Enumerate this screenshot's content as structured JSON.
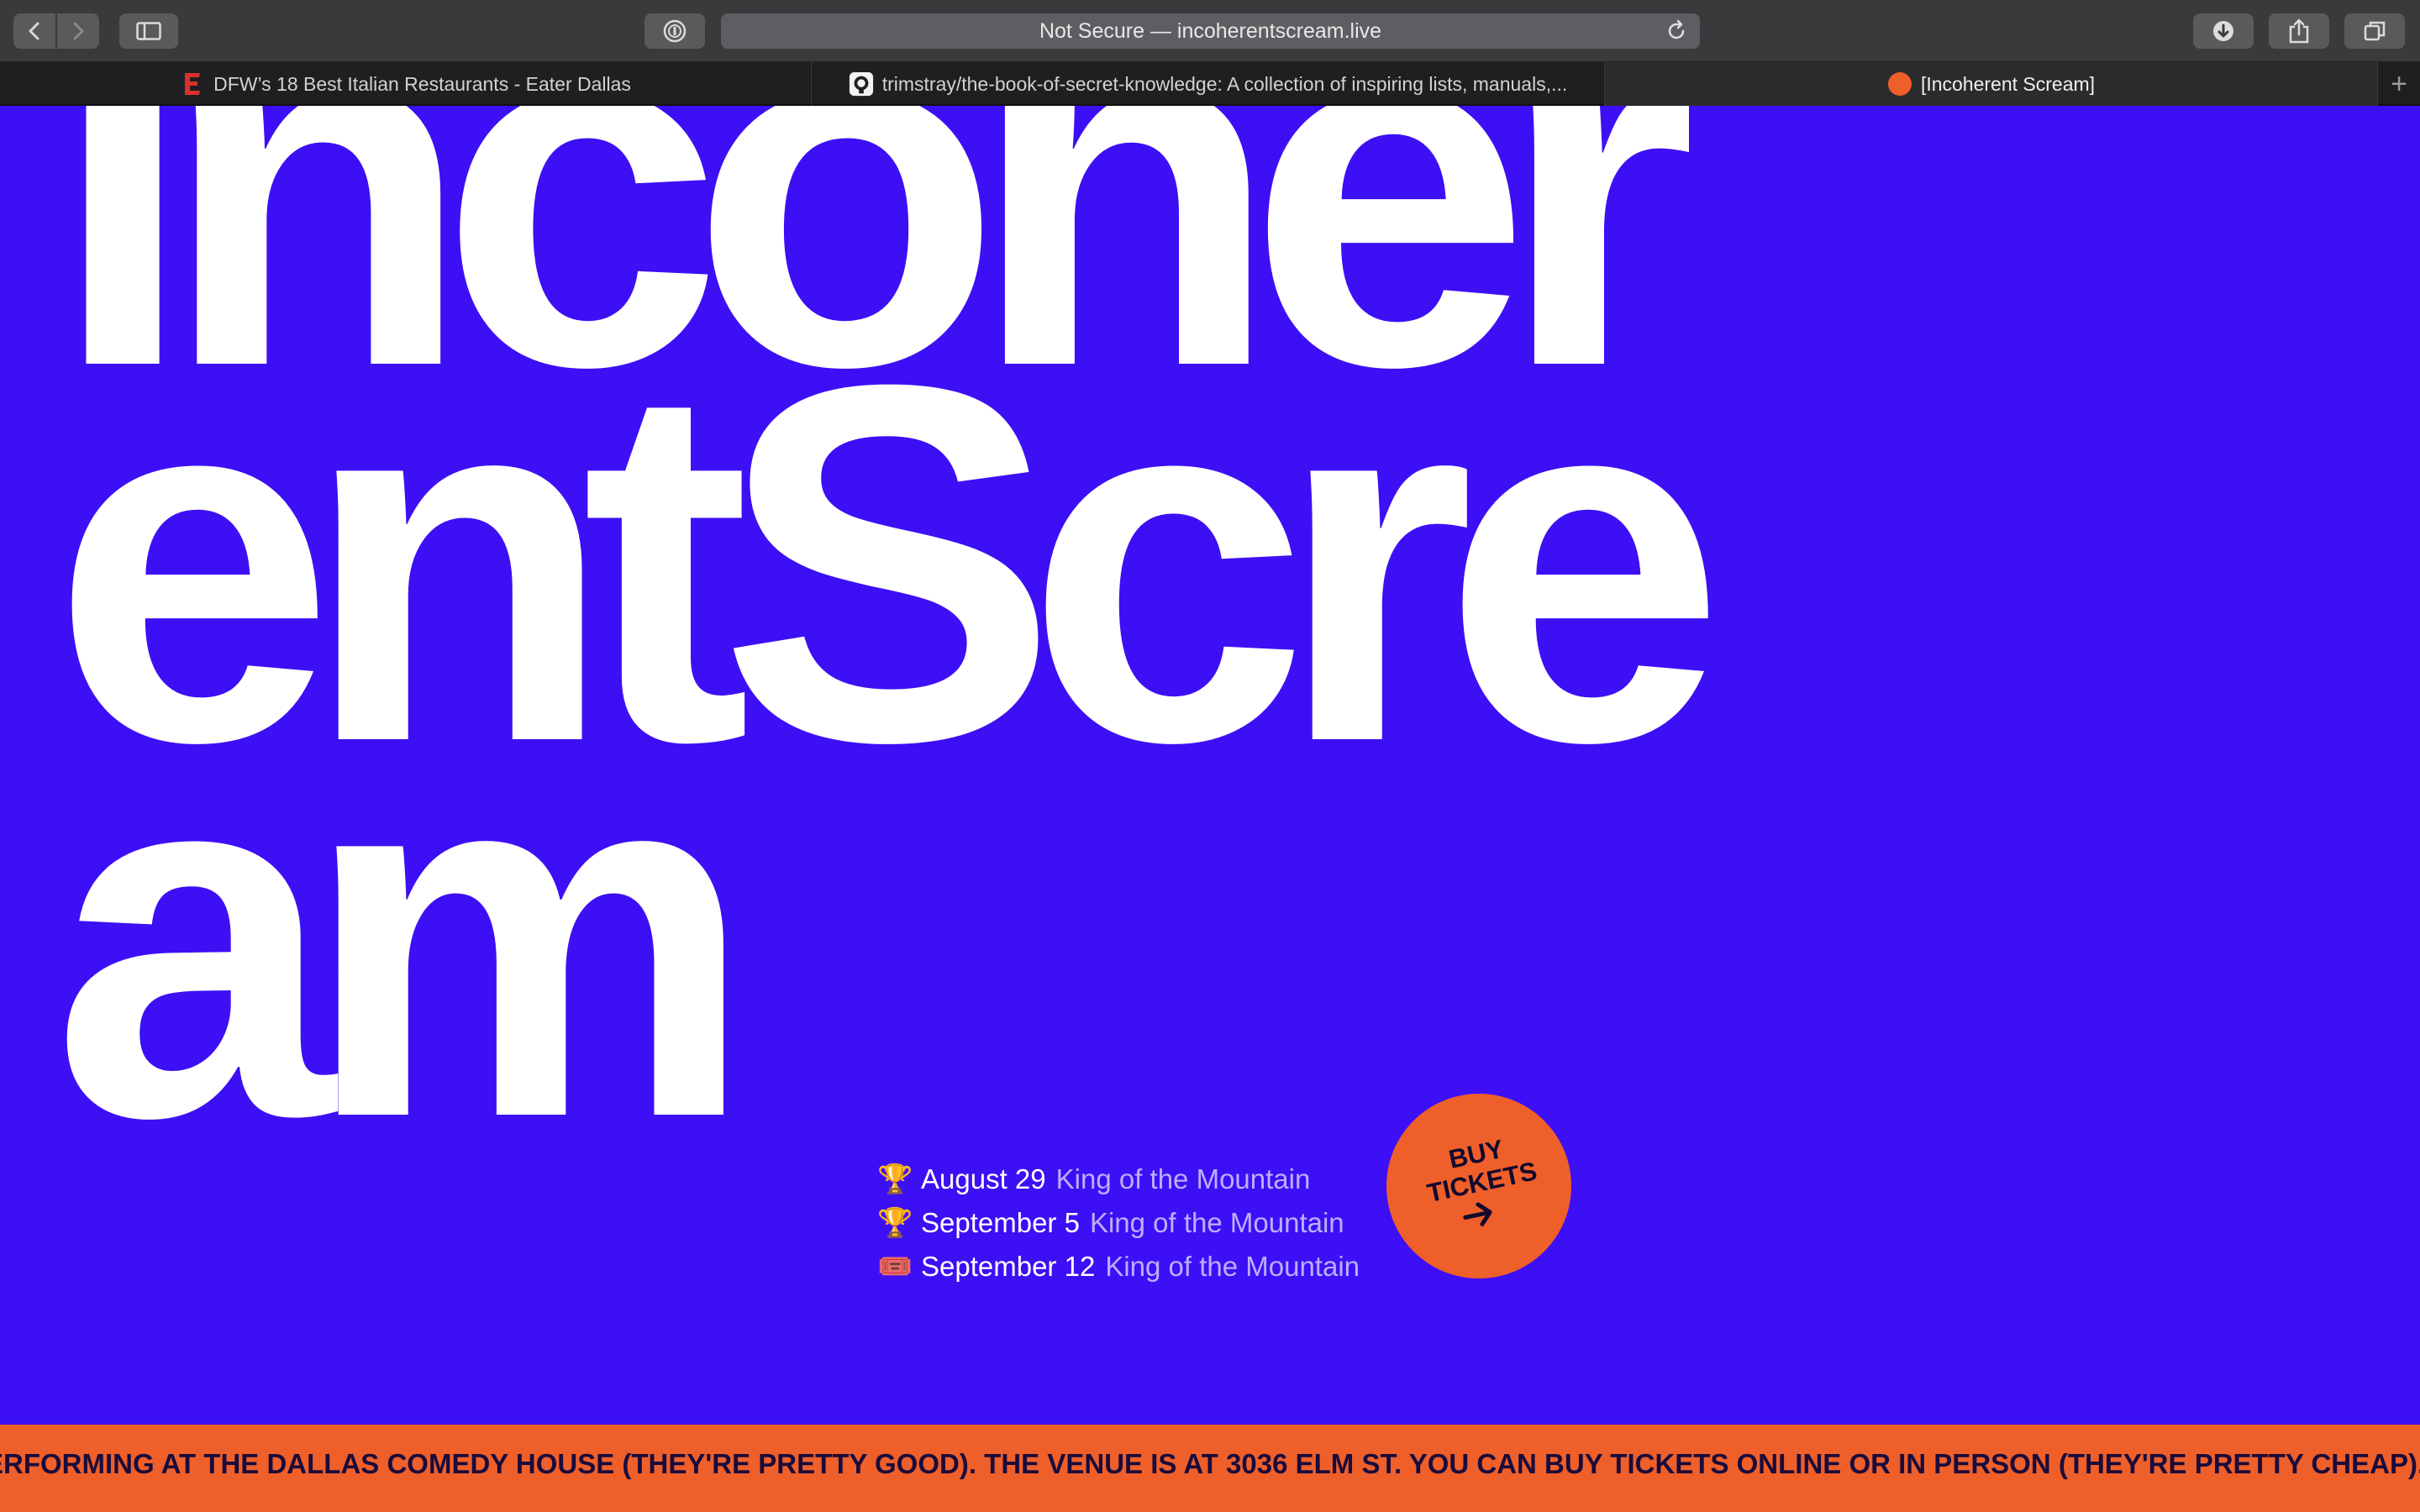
{
  "browser": {
    "address": "Not Secure — incoherentscream.live",
    "tabs": [
      {
        "label": "DFW’s 18 Best Italian Restaurants - Eater Dallas",
        "favicon": "eater-icon"
      },
      {
        "label": "trimstray/the-book-of-secret-knowledge: A collection of inspiring lists, manuals,...",
        "favicon": "github-icon"
      },
      {
        "label": "[Incoherent Scream]",
        "favicon": "orange-dot-icon",
        "active": true
      }
    ],
    "new_tab": "+"
  },
  "page": {
    "headline_lines": [
      "Incoher",
      "entScre",
      "am"
    ],
    "shows": [
      {
        "emoji": "🏆",
        "date": "August 29",
        "title": "King of the Mountain"
      },
      {
        "emoji": "🏆",
        "date": "September 5",
        "title": "King of the Mountain"
      },
      {
        "emoji": "🎟️",
        "date": "September 12",
        "title": "King of the Mountain"
      }
    ],
    "buy_tickets": {
      "line1": "BUY",
      "line2": "TICKETS",
      "arrow": "➔"
    },
    "marquee": "ERFORMING AT THE DALLAS COMEDY HOUSE (THEY'RE PRETTY GOOD). THE VENUE IS AT 3036 ELM ST. YOU CAN BUY TICKETS ONLINE OR IN PERSON (THEY'RE PRETTY CHEAP)."
  },
  "colors": {
    "background": "#3d0ff5",
    "accent": "#ef5f2a",
    "muted_text": "#b8b0ff"
  }
}
